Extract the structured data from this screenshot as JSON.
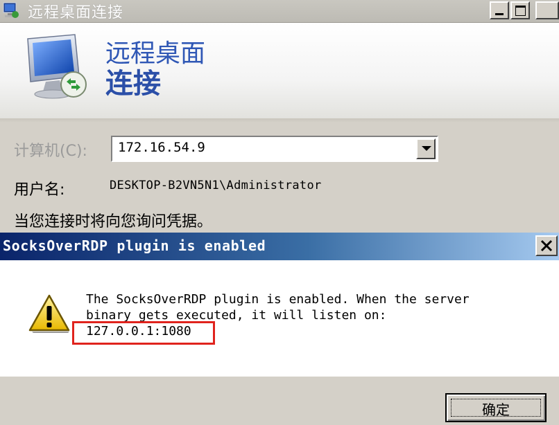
{
  "rdp_window": {
    "title": "远程桌面连接",
    "header_line1": "远程桌面",
    "header_line2": "连接",
    "computer_label": "计算机(C):",
    "computer_value": "172.16.54.9",
    "user_label": "用户名:",
    "user_value": "DESKTOP-B2VN5N1\\Administrator",
    "credentials_note": "当您连接时将向您询问凭据。"
  },
  "plugin_dialog": {
    "title": "SocksOverRDP plugin is enabled",
    "message_line1": "The SocksOverRDP plugin is enabled. When the server",
    "message_line2": "binary gets executed, it will listen on:",
    "message_line3": "127.0.0.1:1080",
    "ok_label": "确定"
  },
  "icons": {
    "rdp_title_icon": "computer-icon",
    "rdp_logo": "remote-desktop-icon",
    "warning": "warning-icon",
    "close": "close-icon"
  },
  "colors": {
    "dialog_title_bg": "#0a246a",
    "highlight_border": "#e0231d",
    "header_text": "#2f57b5"
  }
}
